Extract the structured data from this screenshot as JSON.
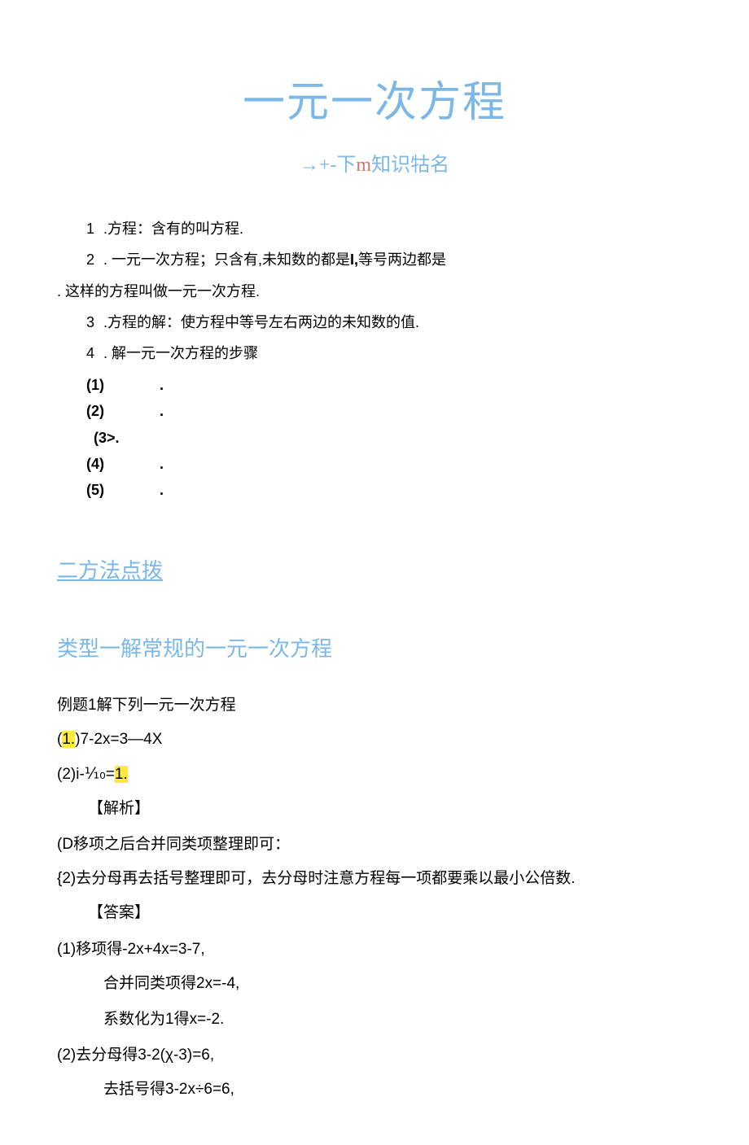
{
  "title": "一元一次方程",
  "subtitle_prefix": "→+-下",
  "subtitle_m": "m",
  "subtitle_suffix": "知识牯名",
  "items": {
    "i1_num": "1",
    "i1_text": " .方程：含有的叫方程.",
    "i2_num": "2",
    "i2_text": " . 一元一次方程；只含有,未知数的都是",
    "i2_tail": "I,",
    "i2_text2": "等号两边都是",
    "i2_cont": ". 这样的方程叫做一元一次方程.",
    "i3_num": "3",
    "i3_text": " .方程的解：使方程中等号左右两边的未知数的值.",
    "i4_num": "4",
    "i4_text": " . 解一元一次方程的步骤"
  },
  "steps": {
    "s1": "(1)",
    "s2": "(2)",
    "s3": "(3>.",
    "s4": "(4)",
    "s5": "(5)",
    "dot": "."
  },
  "section2": "二方法点拨",
  "type1": "类型一解常规的一元一次方程",
  "ex_intro": "例题1解下列一元一次方程",
  "eq1_open": "(",
  "eq1_hl": "1.",
  "eq1_close": ")7-2x=3—4X",
  "eq2_a": "(2)i-⅒=",
  "eq2_hl": "1.",
  "analysis_label": "【解析】",
  "an1": "(D移项之后合并同类项整理即可：",
  "an2": "{2)去分母再去括号整理即可，去分母时注意方程每一项都要乘以最小公倍数.",
  "answer_label": "【答案】",
  "sol1_a": "(1)移项得-2x+4x=3-7,",
  "sol1_b": "合并同类项得2x=-4,",
  "sol1_c": "系数化为1得x=-2.",
  "sol2_a": "(2)去分母得3-2(χ-3)=6,",
  "sol2_b": "去括号得3-2x÷6=6,"
}
